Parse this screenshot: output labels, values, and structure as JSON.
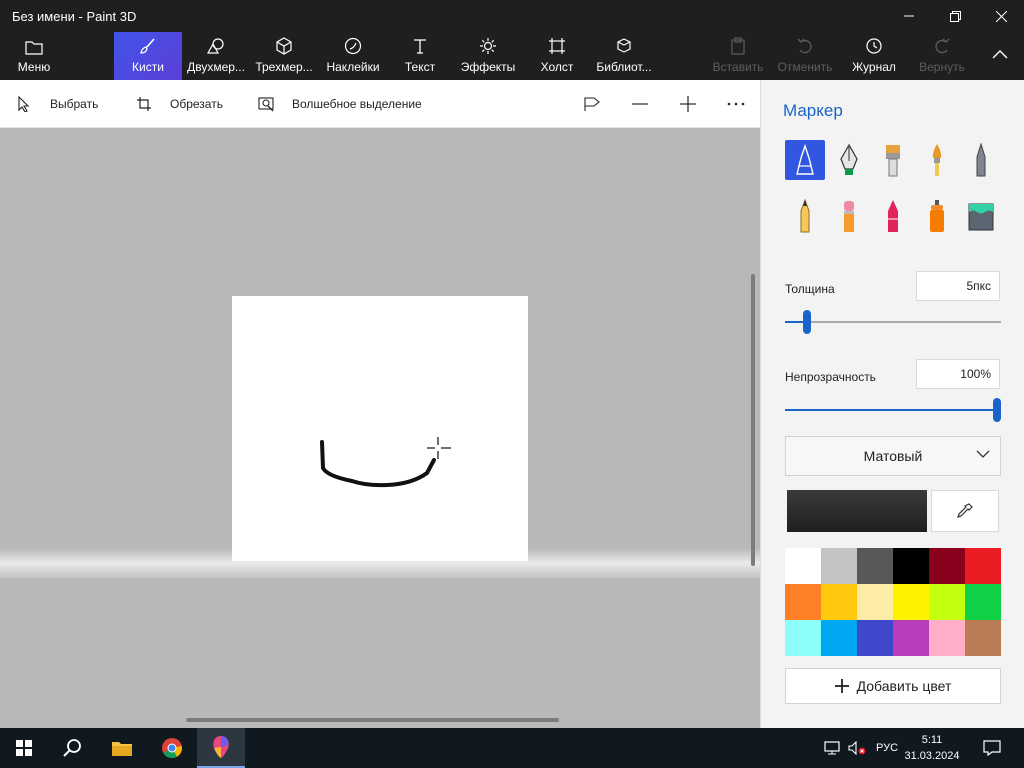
{
  "window": {
    "title": "Без имени - Paint 3D"
  },
  "ribbon": {
    "menu": "Меню",
    "brushes": "Кисти",
    "shapes2d": "Двухмер...",
    "shapes3d": "Трехмер...",
    "stickers": "Наклейки",
    "text": "Текст",
    "effects": "Эффекты",
    "canvas": "Холст",
    "library": "Библиот...",
    "paste": "Вставить",
    "undo": "Отменить",
    "history": "Журнал",
    "redo": "Вернуть"
  },
  "subtoolbar": {
    "select": "Выбрать",
    "crop": "Обрезать",
    "magic_select": "Волшебное выделение"
  },
  "panel": {
    "title": "Маркер",
    "thickness_label": "Толщина",
    "thickness_value": "5пкс",
    "thickness_fraction": 0.05,
    "opacity_label": "Непрозрачность",
    "opacity_value": "100%",
    "opacity_fraction": 1.0,
    "finish": "Матовый",
    "add_color": "Добавить цвет",
    "current_color": "#1f1f1f",
    "palette": [
      "#ffffff",
      "#c3c3c3",
      "#585858",
      "#000000",
      "#88001b",
      "#ec1c24",
      "#ff7f27",
      "#ffc90e",
      "#fdeca6",
      "#fff200",
      "#c4ff0e",
      "#0ed145",
      "#8cfffb",
      "#00a8f3",
      "#3f48cc",
      "#b83dba",
      "#ffaec8",
      "#b97a56"
    ]
  },
  "taskbar": {
    "language": "РУС",
    "time": "5:11",
    "date": "31.03.2024"
  },
  "colors": {
    "accent": "#3156e0",
    "ribbon_bg": "#1f1f1f",
    "workspace_bg": "#b6b8b9"
  }
}
